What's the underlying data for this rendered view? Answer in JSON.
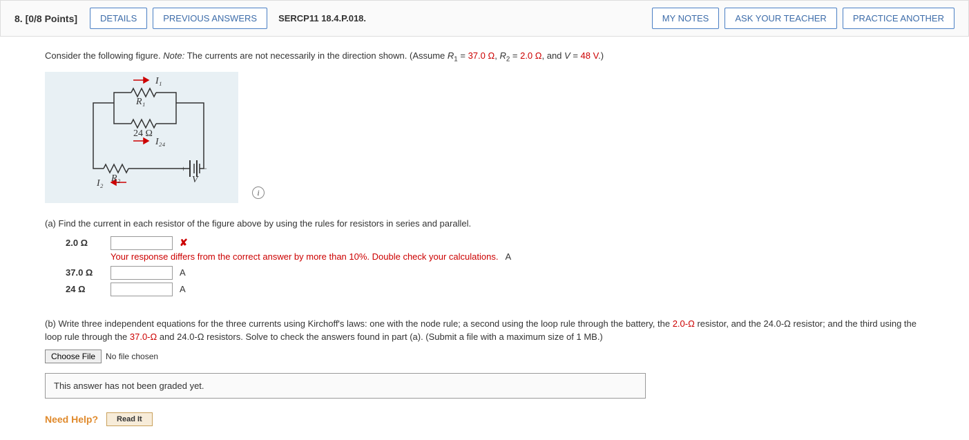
{
  "header": {
    "question_number": "8. [0/8 Points]",
    "details_btn": "DETAILS",
    "previous_btn": "PREVIOUS ANSWERS",
    "problem_id": "SERCP11 18.4.P.018.",
    "my_notes_btn": "MY NOTES",
    "ask_teacher_btn": "ASK YOUR TEACHER",
    "practice_btn": "PRACTICE ANOTHER"
  },
  "prompt": {
    "lead": "Consider the following figure. ",
    "note_label": "Note:",
    "note_body": " The currents are not necessarily in the direction shown. (Assume ",
    "r1_sym": "R",
    "r1_sub": "1",
    "r1_eq": " = ",
    "r1_val": "37.0 Ω",
    "sep1": ", ",
    "r2_sym": "R",
    "r2_sub": "2",
    "r2_eq": " = ",
    "r2_val": "2.0 Ω",
    "sep2": ", and ",
    "v_sym": "V",
    "v_eq": " = ",
    "v_val": "48 V",
    "end": ".)"
  },
  "figure": {
    "i1": "I₁",
    "r1": "R₁",
    "r24": "24 Ω",
    "i24": "I₂₄",
    "r2": "R₂",
    "i2": "I₂",
    "plus": "+",
    "minus": "−",
    "v": "V",
    "info": "i"
  },
  "part_a": {
    "text": "(a) Find the current in each resistor of the figure above by using the rules for resistors in series and parallel.",
    "rows": [
      {
        "label": "2.0 Ω",
        "value": "",
        "wrong": true,
        "feedback": "Your response differs from the correct answer by more than 10%. Double check your calculations.",
        "unit": "A"
      },
      {
        "label": "37.0 Ω",
        "value": "",
        "wrong": false,
        "feedback": "",
        "unit": "A"
      },
      {
        "label": "24 Ω",
        "value": "",
        "wrong": false,
        "feedback": "",
        "unit": "A"
      }
    ]
  },
  "part_b": {
    "lead": "(b) Write three independent equations for the three currents using Kirchoff's laws: one with the node rule; a second using the loop rule through the battery, the ",
    "v1": "2.0-Ω",
    "mid1": " resistor, and the 24.0-Ω resistor; and the third using the loop rule through the ",
    "v2": "37.0-Ω",
    "mid2": " and 24.0-Ω resistors. Solve to check the answers found in part (a). (Submit a file with a maximum size of 1 MB.)",
    "choose_file": "Choose File",
    "no_file": "No file chosen"
  },
  "essay_box": "This answer has not been graded yet.",
  "need_help": {
    "label": "Need Help?",
    "read_it": "Read It"
  }
}
